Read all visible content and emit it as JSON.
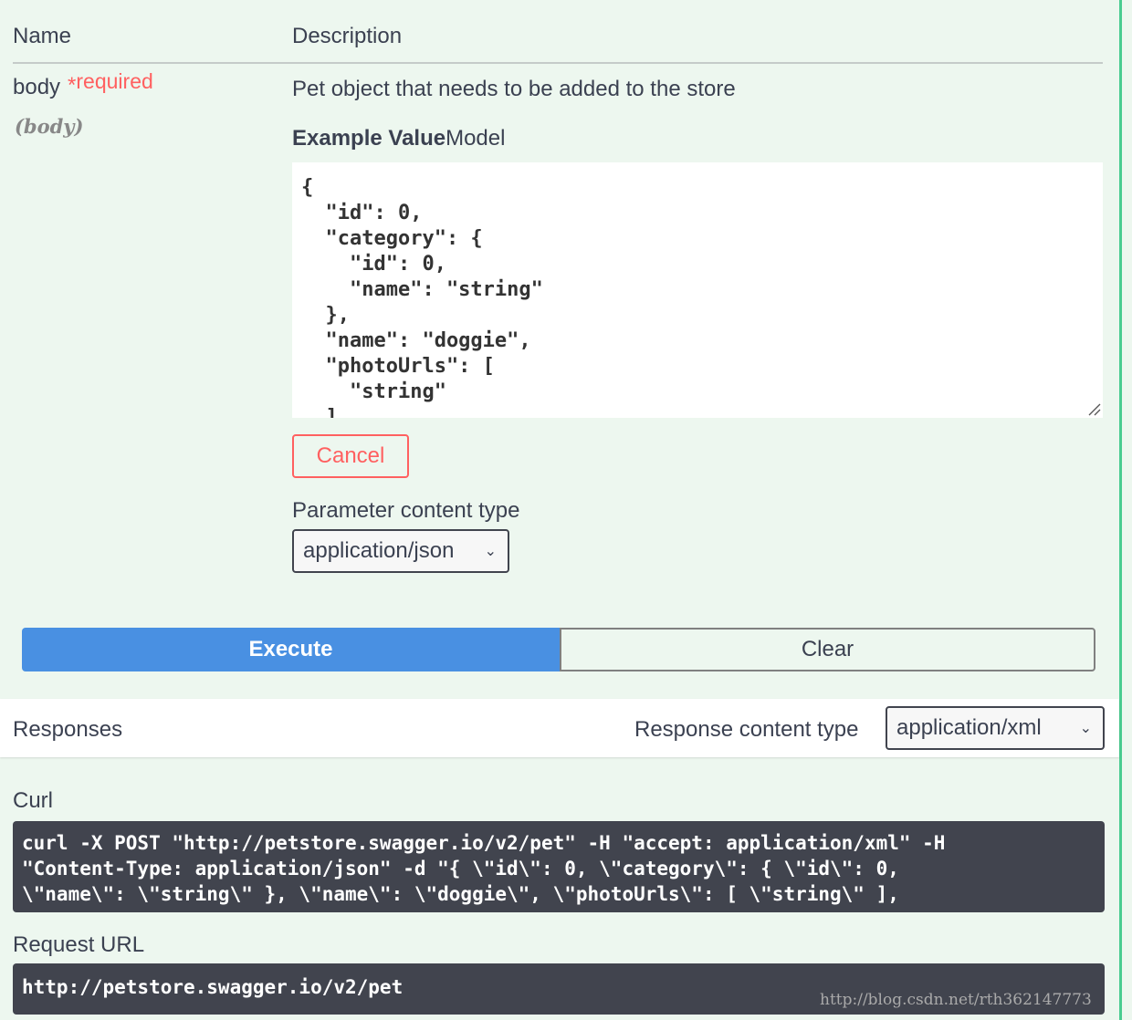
{
  "params_header": {
    "name_col": "Name",
    "description_col": "Description"
  },
  "parameter": {
    "name": "body",
    "required_star": "*",
    "required_label": "required",
    "location": "(body)",
    "description": "Pet object that needs to be added to the store",
    "model_tabs": {
      "example": "Example Value",
      "model": "Model"
    },
    "example_value": "{\n  \"id\": 0,\n  \"category\": {\n    \"id\": 0,\n    \"name\": \"string\"\n  },\n  \"name\": \"doggie\",\n  \"photoUrls\": [\n    \"string\"\n  ],",
    "cancel_label": "Cancel",
    "content_type_label": "Parameter content type",
    "content_type_value": "application/json"
  },
  "actions": {
    "execute_label": "Execute",
    "clear_label": "Clear"
  },
  "responses": {
    "title": "Responses",
    "content_type_label": "Response content type",
    "content_type_value": "application/xml"
  },
  "curl": {
    "label": "Curl",
    "command": "curl -X POST \"http://petstore.swagger.io/v2/pet\" -H \"accept: application/xml\" -H\n\"Content-Type: application/json\" -d \"{ \\\"id\\\": 0, \\\"category\\\": { \\\"id\\\": 0,\n\\\"name\\\": \\\"string\\\" }, \\\"name\\\": \\\"doggie\\\", \\\"photoUrls\\\": [ \\\"string\\\" ],"
  },
  "request_url": {
    "label": "Request URL",
    "value": "http://petstore.swagger.io/v2/pet"
  },
  "watermark": "http://blog.csdn.net/rth362147773",
  "icons": {
    "dropdown": "chevron-down-icon",
    "resize": "resize-grip-icon"
  },
  "colors": {
    "execute": "#4990e2",
    "required": "#ff6060",
    "accent_rule": "#49cc90",
    "code_bg": "#41444e"
  }
}
